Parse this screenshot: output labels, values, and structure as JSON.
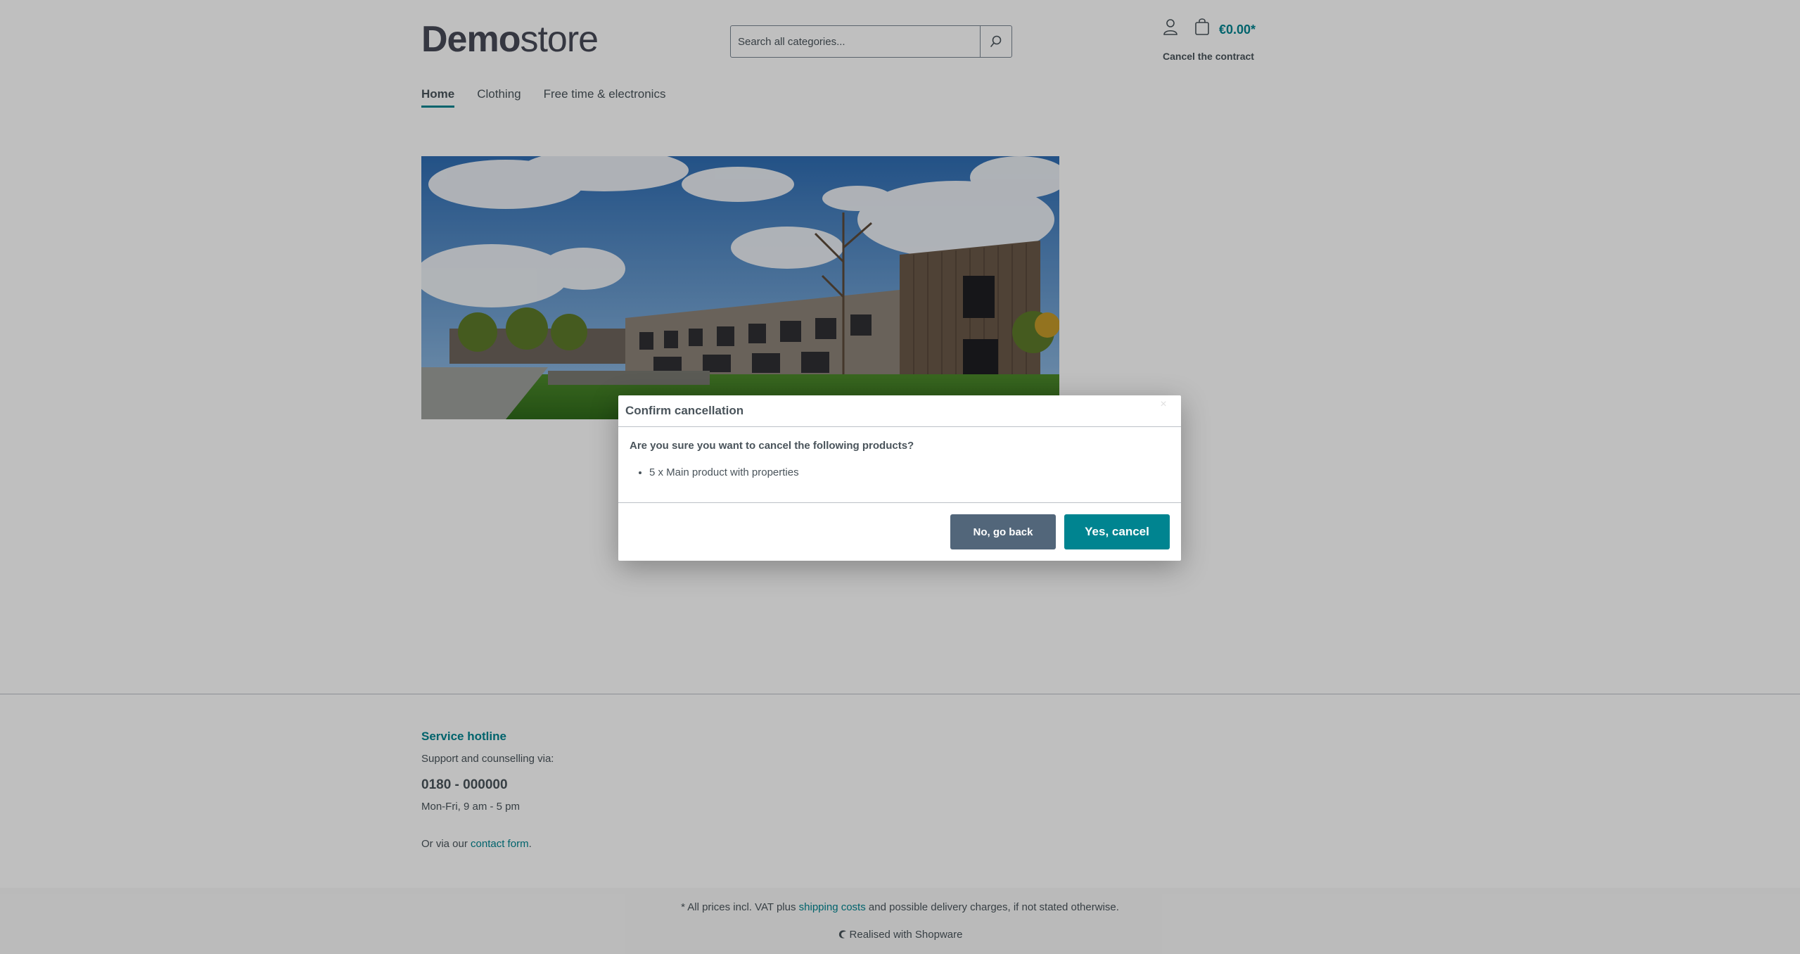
{
  "header": {
    "logo_bold": "Demo",
    "logo_light": "store",
    "search_placeholder": "Search all categories...",
    "cart_total": "€0.00*",
    "cancel_contract": "Cancel the contract"
  },
  "nav": {
    "items": [
      {
        "label": "Home",
        "active": true
      },
      {
        "label": "Clothing",
        "active": false
      },
      {
        "label": "Free time & electronics",
        "active": false
      }
    ]
  },
  "footer": {
    "hotline_title": "Service hotline",
    "support_text": "Support and counselling via:",
    "phone": "0180 - 000000",
    "hours": "Mon-Fri, 9 am - 5 pm",
    "contact_prefix": "Or via our ",
    "contact_link": "contact form",
    "contact_suffix": ".",
    "vat_prefix": "* All prices incl. VAT plus ",
    "vat_link": "shipping costs",
    "vat_suffix": " and possible delivery charges, if not stated otherwise.",
    "realised": "Realised with Shopware"
  },
  "modal": {
    "title": "Confirm cancellation",
    "question": "Are you sure you want to cancel the following products?",
    "items": [
      "5 x Main product with properties"
    ],
    "back_label": "No, go back",
    "confirm_label": "Yes, cancel"
  },
  "colors": {
    "accent": "#008490",
    "text": "#4a545b",
    "secondary_button": "#52667a"
  },
  "icons": [
    "search-icon",
    "account-icon",
    "cart-icon",
    "shopware-logo-icon",
    "close-icon"
  ]
}
